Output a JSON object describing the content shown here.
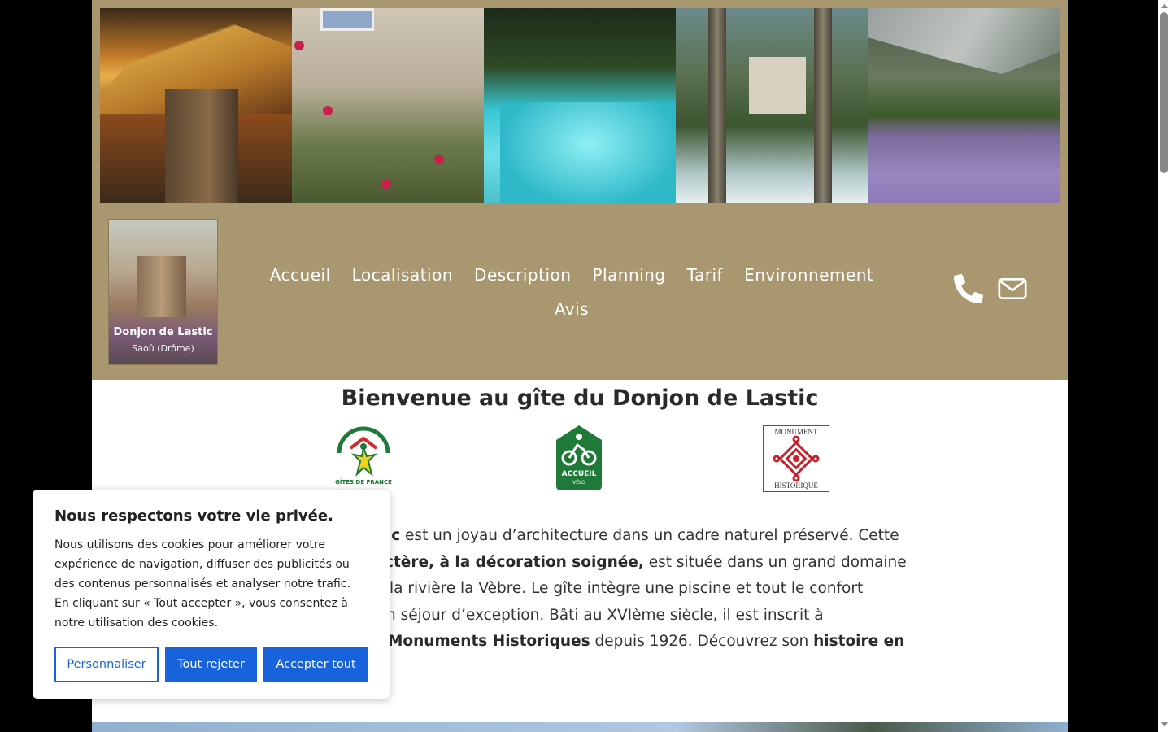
{
  "header": {
    "photos": [
      "chateau-sunset-photo",
      "roses-wall-photo",
      "pool-photo",
      "waterfall-photo",
      "lavender-photo"
    ],
    "logo": {
      "title": "Donjon de Lastic",
      "subtitle": "Saoû (Drôme)"
    },
    "nav": [
      "Accueil",
      "Localisation",
      "Description",
      "Planning",
      "Tarif",
      "Environnement",
      "Avis"
    ],
    "contact_icons": [
      "phone-icon",
      "mail-icon"
    ],
    "banner_color": "#a8976f"
  },
  "main": {
    "title": "Bienvenue au gîte du Donjon de Lastic",
    "badges": {
      "gites": "GÎTES DE FRANCE",
      "velo_top": "ACCUEIL",
      "velo_bottom": "VÉLO",
      "mh_top": "MONUMENT",
      "mh_bottom": "HISTORIQUE"
    },
    "para": {
      "l1_bold": "stic",
      "l1_rest": " est un joyau d’architecture dans un cadre naturel préservé. Cette",
      "l2_bold": "ctère, à la décoration soignée,",
      "l2_rest": " est située dans un grand domaine",
      "l3": "la rivière la Vèbre. Le gîte intègre une piscine et tout le confort",
      "l4": "n séjour d’exception. Bâti au XVIème siècle, il est inscrit à",
      "l5_link1": "Monuments Historiques",
      "l5_mid": " depuis 1926. Découvrez son ",
      "l5_link2": "histoire en"
    }
  },
  "cookie": {
    "title": "Nous respectons votre vie privée.",
    "text": "Nous utilisons des cookies pour améliorer votre expérience de navigation, diffuser des publicités ou des contenus personnalisés et analyser notre trafic. En cliquant sur « Tout accepter », vous consentez à notre utilisation des cookies.",
    "customize": "Personnaliser",
    "reject": "Tout rejeter",
    "accept": "Accepter tout",
    "accent": "#1863dc"
  }
}
